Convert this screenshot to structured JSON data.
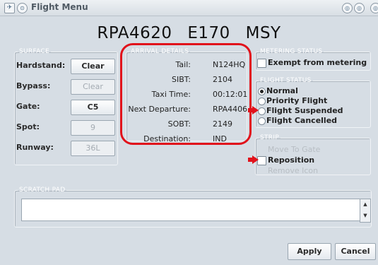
{
  "window": {
    "title": "Flight Menu"
  },
  "flight": {
    "callsign": "RPA4620",
    "aircraft": "E170",
    "airport": "MSY"
  },
  "surface": {
    "legend": "SURFACE",
    "rows": [
      {
        "label": "Hardstand:",
        "button": "Clear",
        "enabled": true
      },
      {
        "label": "Bypass:",
        "button": "Clear",
        "enabled": false
      },
      {
        "label": "Gate:",
        "button": "C5",
        "enabled": true
      },
      {
        "label": "Spot:",
        "button": "9",
        "enabled": false
      },
      {
        "label": "Runway:",
        "button": "36L",
        "enabled": false
      }
    ]
  },
  "arrival": {
    "legend": "ARRIVAL DETAILS",
    "rows": [
      {
        "label": "Tail:",
        "value": "N124HQ"
      },
      {
        "label": "SIBT:",
        "value": "2104"
      },
      {
        "label": "Taxi Time:",
        "value": "00:12:01"
      },
      {
        "label": "Next Departure:",
        "value": "RPA4406"
      },
      {
        "label": "SOBT:",
        "value": "2149"
      },
      {
        "label": "Destination:",
        "value": "IND"
      }
    ]
  },
  "metering": {
    "legend": "METERING STATUS",
    "exempt_label": "Exempt from metering"
  },
  "flight_status": {
    "legend": "FLIGHT STATUS",
    "options": [
      "Normal",
      "Priority Flight",
      "Flight Suspended",
      "Flight Cancelled"
    ],
    "selected": "Normal"
  },
  "strip": {
    "legend": "STRIP",
    "move_to_gate": "Move To Gate",
    "reposition": "Reposition",
    "remove_icon": "Remove Icon"
  },
  "scratch_pad": {
    "legend": "SCRATCH PAD",
    "value": ""
  },
  "actions": {
    "apply": "Apply",
    "cancel": "Cancel"
  },
  "colors": {
    "highlight": "#e1121b",
    "background": "#d6dde4"
  }
}
